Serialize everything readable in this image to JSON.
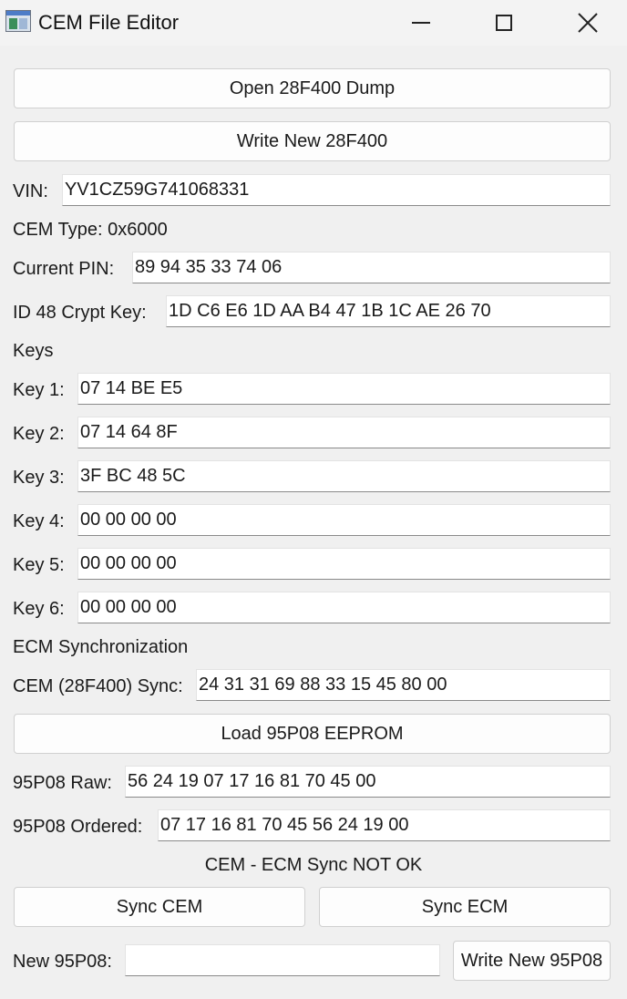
{
  "window": {
    "title": "CEM File Editor"
  },
  "buttons": {
    "open_dump": "Open 28F400 Dump",
    "write_dump": "Write New 28F400",
    "load_eeprom": "Load 95P08 EEPROM",
    "sync_cem": "Sync CEM",
    "sync_ecm": "Sync ECM",
    "write_95p08": "Write New 95P08"
  },
  "vin": {
    "label": "VIN:",
    "value": "YV1CZ59G741068331"
  },
  "cem_type": {
    "text": "CEM Type: 0x6000"
  },
  "current_pin": {
    "label": "Current PIN:",
    "value": "89 94 35 33 74 06"
  },
  "crypt_key": {
    "label": "ID 48 Crypt Key:",
    "value": "1D C6 E6 1D AA B4 47 1B 1C AE 26 70"
  },
  "keys": {
    "heading": "Keys",
    "items": [
      {
        "label": "Key 1:",
        "value": "07 14 BE E5"
      },
      {
        "label": "Key 2:",
        "value": "07 14 64 8F"
      },
      {
        "label": "Key 3:",
        "value": "3F BC 48 5C"
      },
      {
        "label": "Key 4:",
        "value": "00 00 00 00"
      },
      {
        "label": "Key 5:",
        "value": "00 00 00 00"
      },
      {
        "label": "Key 6:",
        "value": "00 00 00 00"
      }
    ]
  },
  "ecm": {
    "heading": "ECM Synchronization",
    "cem_sync_label": "CEM (28F400) Sync:",
    "cem_sync_value": "24 31 31 69 88 33 15 45 80 00",
    "raw_label": "95P08 Raw:",
    "raw_value": "56 24 19 07 17 16 81 70 45 00",
    "ordered_label": "95P08 Ordered:",
    "ordered_value": "07 17 16 81 70 45 56 24 19 00",
    "status": "CEM - ECM Sync NOT OK",
    "new_label": "New 95P08:",
    "new_value": ""
  },
  "icons": {
    "app": "app-window-icon",
    "minimize": "minimize-icon",
    "maximize": "maximize-icon",
    "close": "close-icon"
  }
}
